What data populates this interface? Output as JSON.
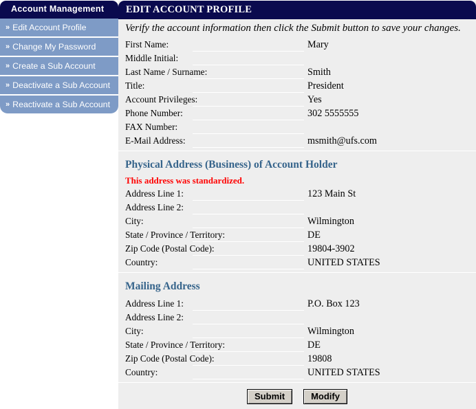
{
  "sidebar": {
    "title": "Account Management",
    "chevron_icon": "double-chevron-right-icon",
    "items": [
      {
        "label": "Edit Account Profile"
      },
      {
        "label": "Change My Password"
      },
      {
        "label": "Create a  Sub Account"
      },
      {
        "label": "Deactivate a Sub Account"
      },
      {
        "label": "Reactivate a Sub Account"
      }
    ]
  },
  "main": {
    "header": "EDIT ACCOUNT PROFILE",
    "intro": "Verify the account information then click the Submit button to save your changes.",
    "account_rows": [
      {
        "label": "First Name:",
        "value": "Mary"
      },
      {
        "label": "Middle Initial:",
        "value": ""
      },
      {
        "label": "Last Name / Surname:",
        "value": "Smith"
      },
      {
        "label": "Title:",
        "value": "President"
      },
      {
        "label": "Account Privileges:",
        "value": "Yes"
      },
      {
        "label": "Phone Number:",
        "value": "302 5555555"
      },
      {
        "label": "FAX Number:",
        "value": ""
      },
      {
        "label": "E-Mail Address:",
        "value": "msmith@ufs.com"
      }
    ],
    "physical_section": {
      "heading": "Physical Address (Business) of Account Holder",
      "warning": "This address was standardized.",
      "rows": [
        {
          "label": "Address Line 1:",
          "value": "123 Main St"
        },
        {
          "label": "Address Line 2:",
          "value": ""
        },
        {
          "label": "City:",
          "value": "Wilmington"
        },
        {
          "label": "State / Province / Territory:",
          "value": "DE"
        },
        {
          "label": "Zip Code (Postal Code):",
          "value": "19804-3902"
        },
        {
          "label": "Country:",
          "value": "UNITED STATES"
        }
      ]
    },
    "mailing_section": {
      "heading": "Mailing Address",
      "rows": [
        {
          "label": "Address Line 1:",
          "value": "P.O. Box 123"
        },
        {
          "label": "Address Line 2:",
          "value": ""
        },
        {
          "label": "City:",
          "value": "Wilmington"
        },
        {
          "label": "State / Province / Territory:",
          "value": "DE"
        },
        {
          "label": "Zip Code (Postal Code):",
          "value": "19808"
        },
        {
          "label": "Country:",
          "value": "UNITED STATES"
        }
      ]
    },
    "buttons": [
      {
        "label": "Submit"
      },
      {
        "label": "Modify"
      }
    ]
  },
  "colors": {
    "header_navy": "#0a0a4e",
    "sidebar_blue": "#7e9bc6",
    "panel_gray": "#eeeeee",
    "section_heading": "#36648b",
    "warning_red": "#ff0000",
    "button_face": "#d4d0c8"
  }
}
